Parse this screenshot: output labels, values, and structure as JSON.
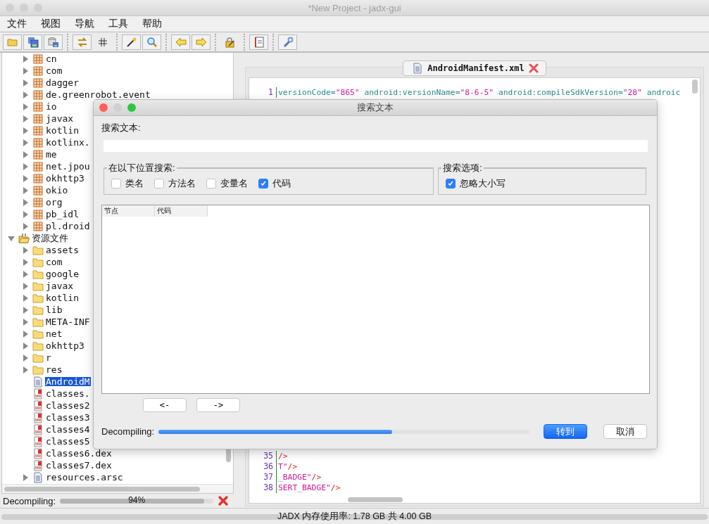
{
  "window": {
    "title": "*New Project - jadx-gui"
  },
  "menu": [
    {
      "label": "文件"
    },
    {
      "label": "视图"
    },
    {
      "label": "导航"
    },
    {
      "label": "工具"
    },
    {
      "label": "帮助"
    }
  ],
  "tree": {
    "continued": [
      {
        "label": "cn",
        "kind": "package",
        "expanded": false,
        "selected": false
      },
      {
        "label": "com",
        "kind": "package",
        "expanded": false,
        "selected": false
      },
      {
        "label": "dagger",
        "kind": "package",
        "expanded": false,
        "selected": false
      },
      {
        "label": "de.greenrobot.event",
        "kind": "package",
        "expanded": false,
        "selected": false
      },
      {
        "label": "io",
        "kind": "package",
        "expanded": false,
        "selected": false
      },
      {
        "label": "javax",
        "kind": "package",
        "expanded": false,
        "selected": false
      },
      {
        "label": "kotlin",
        "kind": "package",
        "expanded": false,
        "selected": false
      },
      {
        "label": "kotlinx.",
        "kind": "package",
        "expanded": false,
        "selected": false
      },
      {
        "label": "me",
        "kind": "package",
        "expanded": false,
        "selected": false
      },
      {
        "label": "net.jpou",
        "kind": "package",
        "expanded": false,
        "selected": false
      },
      {
        "label": "okhttp3",
        "kind": "package",
        "expanded": false,
        "selected": false
      },
      {
        "label": "okio",
        "kind": "package",
        "expanded": false,
        "selected": false
      },
      {
        "label": "org",
        "kind": "package",
        "expanded": false,
        "selected": false
      },
      {
        "label": "pb_idl",
        "kind": "package",
        "expanded": false,
        "selected": false
      },
      {
        "label": "pl.droid",
        "kind": "package",
        "expanded": false,
        "selected": false
      }
    ],
    "roots": [
      {
        "label": "资源文件",
        "kind": "resources",
        "expanded": true,
        "selected": false,
        "children": [
          {
            "label": "assets",
            "kind": "folder",
            "expanded": false,
            "selected": false
          },
          {
            "label": "com",
            "kind": "folder",
            "expanded": false,
            "selected": false
          },
          {
            "label": "google",
            "kind": "folder",
            "expanded": false,
            "selected": false
          },
          {
            "label": "javax",
            "kind": "folder",
            "expanded": false,
            "selected": false
          },
          {
            "label": "kotlin",
            "kind": "folder",
            "expanded": false,
            "selected": false
          },
          {
            "label": "lib",
            "kind": "folder",
            "expanded": false,
            "selected": false
          },
          {
            "label": "META-INF",
            "kind": "folder",
            "expanded": false,
            "selected": false
          },
          {
            "label": "net",
            "kind": "folder",
            "expanded": false,
            "selected": false
          },
          {
            "label": "okhttp3",
            "kind": "folder",
            "expanded": false,
            "selected": false
          },
          {
            "label": "r",
            "kind": "folder",
            "expanded": false,
            "selected": false
          },
          {
            "label": "res",
            "kind": "folder",
            "expanded": false,
            "selected": false
          },
          {
            "label": "AndroidM",
            "kind": "file",
            "selected": true
          },
          {
            "label": "classes.",
            "kind": "dex",
            "selected": false
          },
          {
            "label": "classes2",
            "kind": "dex",
            "selected": false
          },
          {
            "label": "classes3",
            "kind": "dex",
            "selected": false
          },
          {
            "label": "classes4",
            "kind": "dex",
            "selected": false
          },
          {
            "label": "classes5",
            "kind": "dex",
            "selected": false
          },
          {
            "label": "classes6.dex",
            "kind": "dex",
            "selected": false
          },
          {
            "label": "classes7.dex",
            "kind": "dex",
            "selected": false
          },
          {
            "label": "resources.arsc",
            "kind": "file",
            "expanded": false,
            "selected": false
          }
        ]
      }
    ]
  },
  "left_progress": {
    "label": "Decompiling:",
    "level": 0.94,
    "reading": "94%"
  },
  "editor": {
    "tab": {
      "label": "AndroidManifest.xml",
      "selected": true
    },
    "lines": [
      {
        "number": "1",
        "tokens": [
          {
            "kind": "attr",
            "text": "versionCode="
          },
          {
            "kind": "value",
            "text": "\"865\""
          },
          {
            "kind": "attr",
            "text": " android:versionName="
          },
          {
            "kind": "value",
            "text": "\"8-6-5\""
          },
          {
            "kind": "attr",
            "text": " android:compileSdkVersion="
          },
          {
            "kind": "value",
            "text": "\"28\""
          },
          {
            "kind": "attr",
            "text": " androic"
          }
        ]
      },
      {
        "number": "35",
        "tokens": [
          {
            "kind": "punct",
            "text": "/>"
          }
        ]
      },
      {
        "number": "36",
        "tokens": [
          {
            "kind": "value",
            "text": "T\""
          },
          {
            "kind": "punct",
            "text": "/>"
          }
        ]
      },
      {
        "number": "37",
        "tokens": [
          {
            "kind": "value",
            "text": "_BADGE\""
          },
          {
            "kind": "punct",
            "text": "/>"
          }
        ]
      },
      {
        "number": "38",
        "tokens": [
          {
            "kind": "value",
            "text": "SERT_BADGE\""
          },
          {
            "kind": "punct",
            "text": "/>"
          }
        ]
      }
    ]
  },
  "dialog": {
    "title": "搜索文本",
    "search_label": "搜索文本:",
    "where": {
      "title": "在以下位置搜索:",
      "options": [
        {
          "label": "类名",
          "checked": false
        },
        {
          "label": "方法名",
          "checked": false
        },
        {
          "label": "变量名",
          "checked": false
        },
        {
          "label": "代码",
          "checked": true
        }
      ]
    },
    "options": {
      "title": "搜索选项:",
      "options": [
        {
          "label": "忽略大小写",
          "checked": true
        }
      ]
    },
    "table": {
      "columns": [
        "节点",
        "代码"
      ]
    },
    "pager": [
      "<-",
      "->"
    ],
    "progress": {
      "label": "Decompiling:",
      "level": 0.63
    },
    "buttons": [
      {
        "label": "转到",
        "kind": "primary"
      },
      {
        "label": "取消",
        "kind": "normal"
      }
    ]
  },
  "status_bar": {
    "text": "JADX 内存使用率: 1.78 GB 共 4.00 GB"
  }
}
